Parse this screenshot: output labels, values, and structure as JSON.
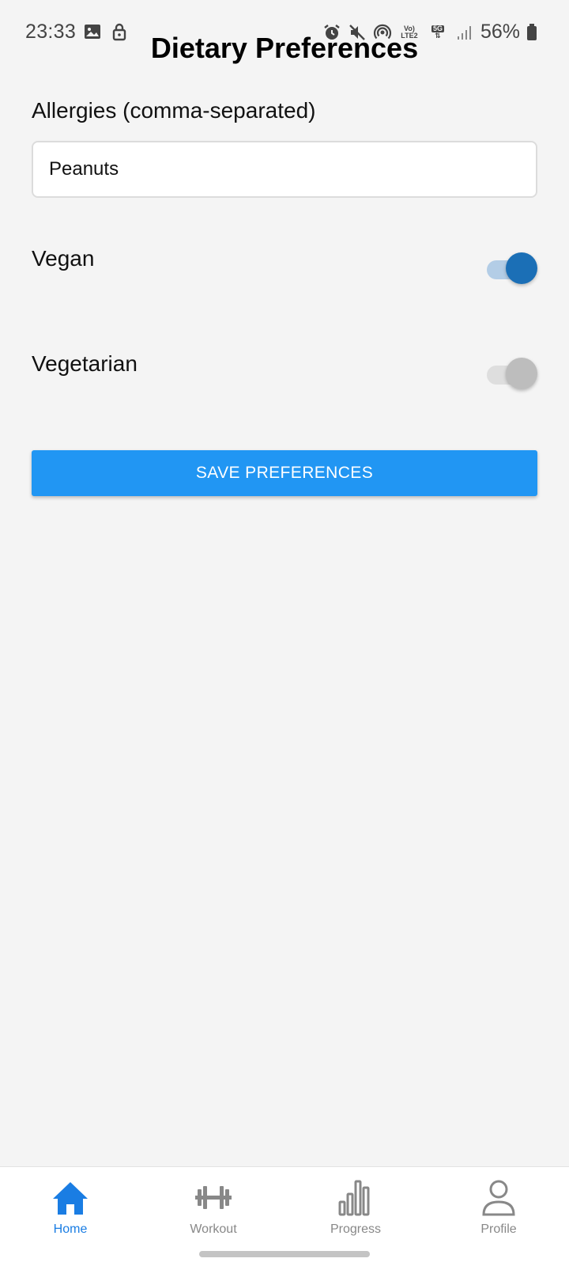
{
  "status_bar": {
    "time": "23:33",
    "network_top": "Vo)",
    "network_bottom": "LTE2",
    "five_g": "5G",
    "battery": "56%"
  },
  "page": {
    "title": "Dietary Preferences"
  },
  "allergies": {
    "label": "Allergies (comma-separated)",
    "value": "Peanuts"
  },
  "preferences": [
    {
      "label": "Vegan",
      "enabled": true
    },
    {
      "label": "Vegetarian",
      "enabled": false
    }
  ],
  "save_button": {
    "label": "SAVE PREFERENCES"
  },
  "nav": {
    "items": [
      {
        "label": "Home",
        "icon": "home-icon",
        "active": true
      },
      {
        "label": "Workout",
        "icon": "dumbbell-icon",
        "active": false
      },
      {
        "label": "Progress",
        "icon": "bar-chart-icon",
        "active": false
      },
      {
        "label": "Profile",
        "icon": "person-icon",
        "active": false
      }
    ]
  },
  "colors": {
    "accent": "#2196f3",
    "toggle_on": "#1b6fb6",
    "nav_active": "#1a7de3"
  }
}
